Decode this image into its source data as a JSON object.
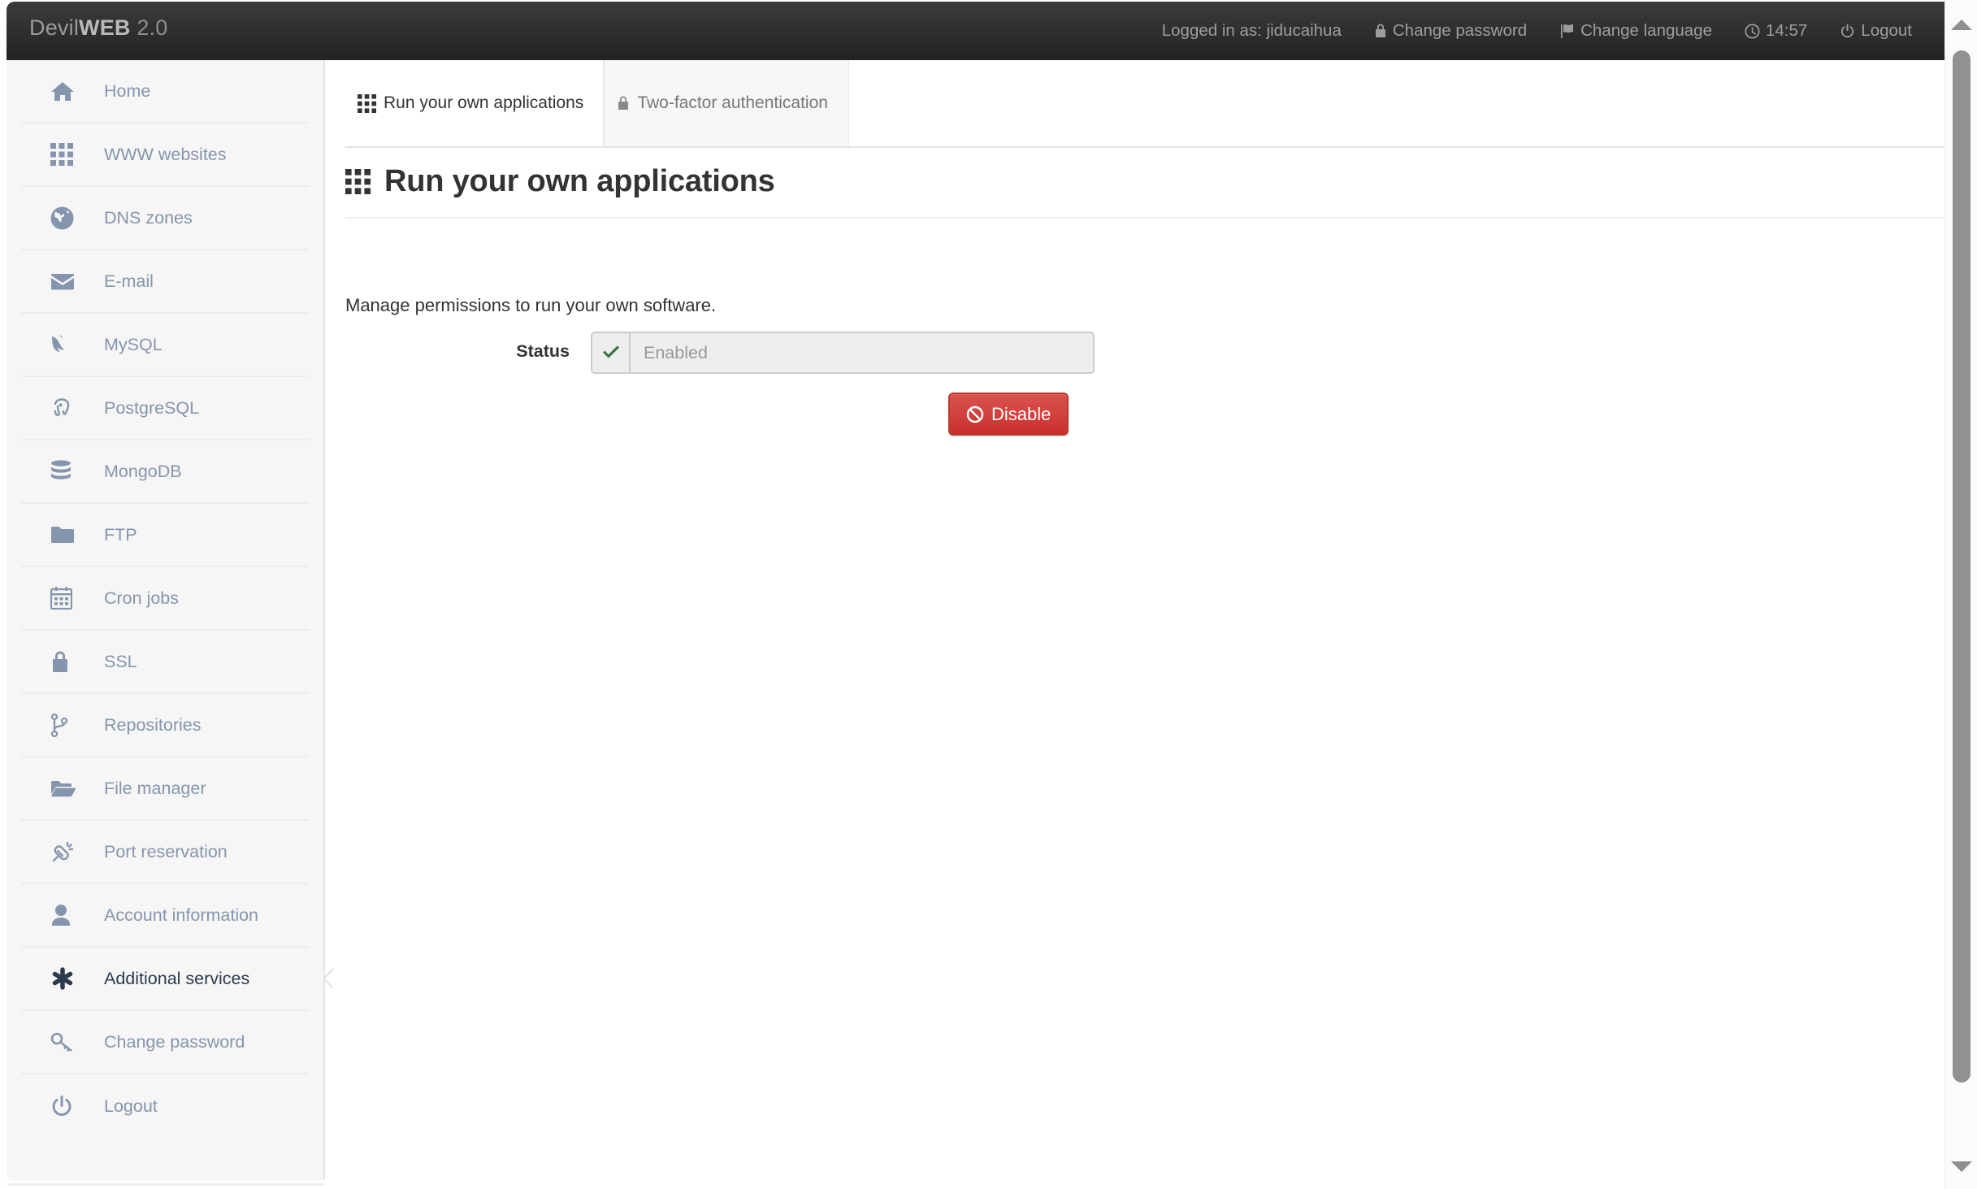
{
  "header": {
    "brand_prefix": "Devil",
    "brand_bold": "WEB",
    "brand_version": "2.0",
    "logged_in_as": "Logged in as: jiducaihua",
    "change_password": "Change password",
    "change_language": "Change language",
    "clock": "14:57",
    "logout": "Logout",
    "icons": {
      "change_password": "lock-icon",
      "change_language": "flag-icon",
      "clock": "clock-icon",
      "logout": "power-icon"
    },
    "background": "#222222",
    "text_color": "#9d9d9d"
  },
  "sidebar": {
    "background": "#f6f6f6",
    "item_color": "#8595ad",
    "active_color": "#2b3a4f",
    "items": [
      {
        "label": "Home",
        "icon": "home-icon",
        "active": false
      },
      {
        "label": "WWW websites",
        "icon": "grid-icon",
        "active": false
      },
      {
        "label": "DNS zones",
        "icon": "globe-icon",
        "active": false
      },
      {
        "label": "E-mail",
        "icon": "envelope-icon",
        "active": false
      },
      {
        "label": "MySQL",
        "icon": "dolphin-icon",
        "active": false
      },
      {
        "label": "PostgreSQL",
        "icon": "elephant-icon",
        "active": false
      },
      {
        "label": "MongoDB",
        "icon": "database-icon",
        "active": false
      },
      {
        "label": "FTP",
        "icon": "folder-icon",
        "active": false
      },
      {
        "label": "Cron jobs",
        "icon": "calendar-icon",
        "active": false
      },
      {
        "label": "SSL",
        "icon": "lock-icon",
        "active": false
      },
      {
        "label": "Repositories",
        "icon": "code-branch-icon",
        "active": false
      },
      {
        "label": "File manager",
        "icon": "folder-open-icon",
        "active": false
      },
      {
        "label": "Port reservation",
        "icon": "plug-icon",
        "active": false
      },
      {
        "label": "Account information",
        "icon": "user-icon",
        "active": false
      },
      {
        "label": "Additional services",
        "icon": "asterisk-icon",
        "active": true
      },
      {
        "label": "Change password",
        "icon": "key-icon",
        "active": false
      },
      {
        "label": "Logout",
        "icon": "power-icon",
        "active": false
      }
    ]
  },
  "tabs": [
    {
      "label": "Run your own applications",
      "icon": "grid-icon",
      "active": true
    },
    {
      "label": "Two-factor authentication",
      "icon": "lock-icon",
      "active": false
    }
  ],
  "main": {
    "title": "Run your own applications",
    "title_icon": "grid-icon",
    "lead": "Manage permissions to run your own software.",
    "status_label": "Status",
    "status_value": "Enabled",
    "status_icon": "check-icon",
    "status_icon_color": "#3c763d",
    "disable_button": "Disable",
    "disable_button_icon": "ban-icon",
    "disable_button_color": "#d9534f"
  },
  "scrollbar": {
    "up_arrow": "triangle-up-icon",
    "down_arrow": "triangle-down-icon",
    "thumb_color": "#919191"
  }
}
